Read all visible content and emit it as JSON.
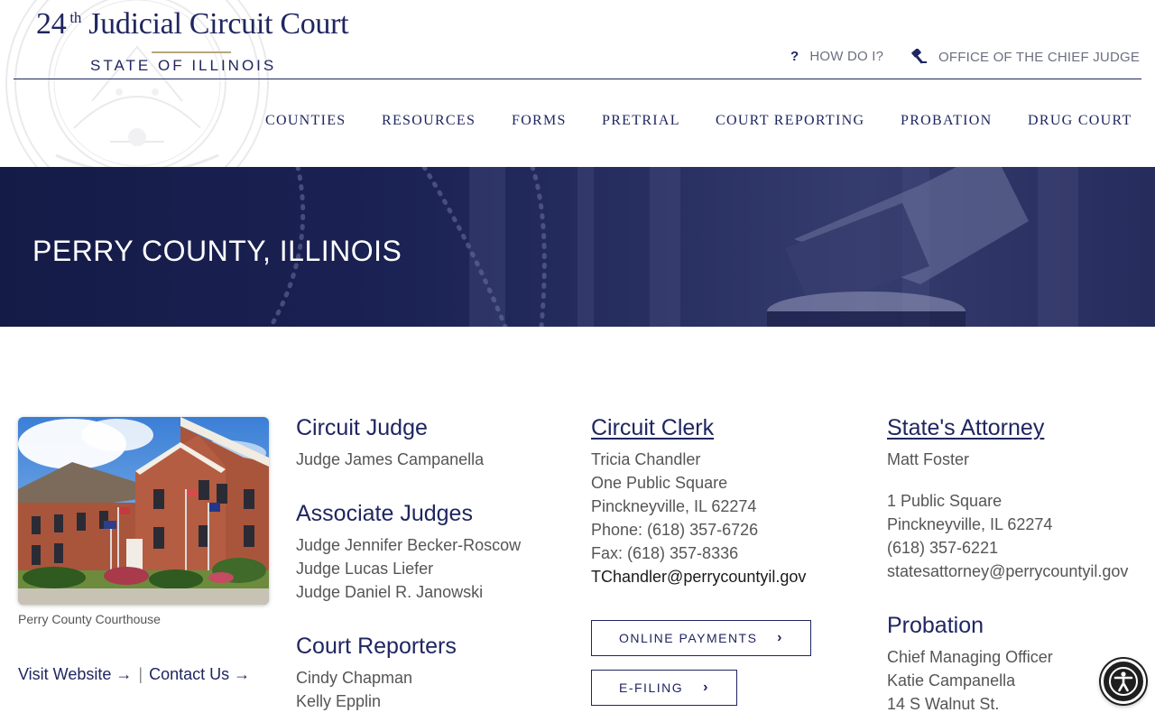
{
  "header": {
    "logo": {
      "number": "24",
      "suffix": "th",
      "title": "Judicial Circuit Court",
      "subtitle": "STATE OF ILLINOIS"
    },
    "utility_links": [
      {
        "label": "HOW DO I?",
        "icon": "question-icon"
      },
      {
        "label": "OFFICE OF THE CHIEF JUDGE",
        "icon": "gavel-icon"
      }
    ],
    "nav": [
      {
        "label": "COUNTIES"
      },
      {
        "label": "RESOURCES"
      },
      {
        "label": "FORMS"
      },
      {
        "label": "PRETRIAL"
      },
      {
        "label": "COURT REPORTING"
      },
      {
        "label": "PROBATION"
      },
      {
        "label": "DRUG COURT"
      }
    ]
  },
  "hero": {
    "title": "PERRY COUNTY, ILLINOIS"
  },
  "courthouse": {
    "caption": "Perry County Courthouse",
    "visit_website": "Visit Website →",
    "separator": "|",
    "contact_us": "Contact Us →"
  },
  "circuit_judge": {
    "heading": "Circuit Judge",
    "name": "Judge James Campanella"
  },
  "associate_judges": {
    "heading": "Associate Judges",
    "names": [
      "Judge Jennifer Becker-Roscow",
      "Judge Lucas Liefer",
      "Judge Daniel R. Janowski"
    ]
  },
  "court_reporters": {
    "heading": "Court Reporters",
    "names": [
      "Cindy Chapman",
      "Kelly Epplin"
    ]
  },
  "circuit_clerk": {
    "heading": "Circuit Clerk",
    "lines": [
      "Tricia Chandler",
      "One Public Square",
      "Pinckneyville, IL 62274",
      "Phone: (618) 357-6726",
      "Fax: (618) 357-8336"
    ],
    "email": "TChandler@perrycountyil.gov",
    "buttons": [
      {
        "label": "ONLINE PAYMENTS"
      },
      {
        "label": "E-FILING"
      }
    ]
  },
  "states_attorney": {
    "heading": "State's Attorney",
    "name": "Matt Foster",
    "lines": [
      "1 Public Square",
      "Pinckneyville, IL 62274",
      "(618) 357-6221",
      "statesattorney@perrycountyil.gov"
    ]
  },
  "probation": {
    "heading": "Probation",
    "lines": [
      "Chief Managing Officer",
      "Katie Campanella",
      "14 S Walnut St."
    ]
  },
  "accessibility": {
    "icon": "accessibility-icon"
  },
  "colors": {
    "brand_navy": "#1f2660",
    "gold_rule": "#b8a77b",
    "body_text": "#555555"
  }
}
